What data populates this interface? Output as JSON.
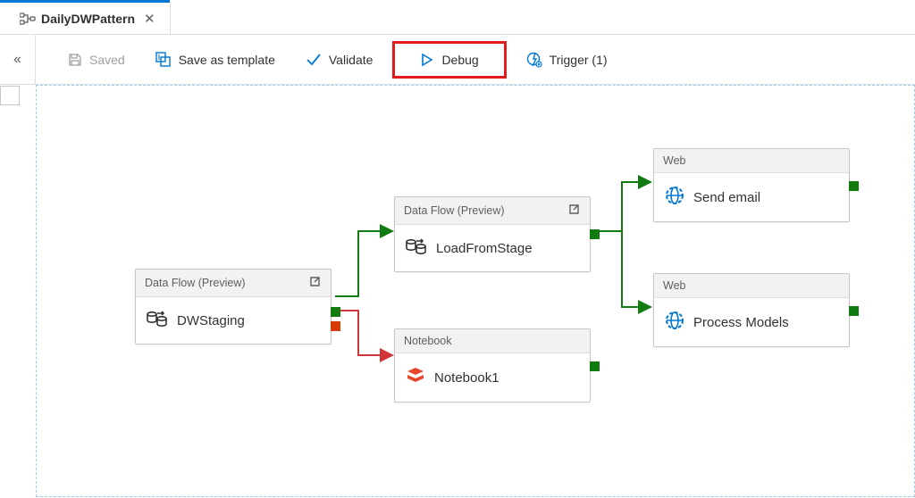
{
  "tab": {
    "title": "DailyDWPattern"
  },
  "toolbar": {
    "saved": "Saved",
    "save_template": "Save as template",
    "validate": "Validate",
    "debug": "Debug",
    "trigger": "Trigger (1)"
  },
  "nodes": {
    "dwstaging": {
      "type": "Data Flow (Preview)",
      "title": "DWStaging"
    },
    "loadstage": {
      "type": "Data Flow (Preview)",
      "title": "LoadFromStage"
    },
    "notebook1": {
      "type": "Notebook",
      "title": "Notebook1"
    },
    "sendemail": {
      "type": "Web",
      "title": "Send email"
    },
    "procmodels": {
      "type": "Web",
      "title": "Process Models"
    }
  }
}
